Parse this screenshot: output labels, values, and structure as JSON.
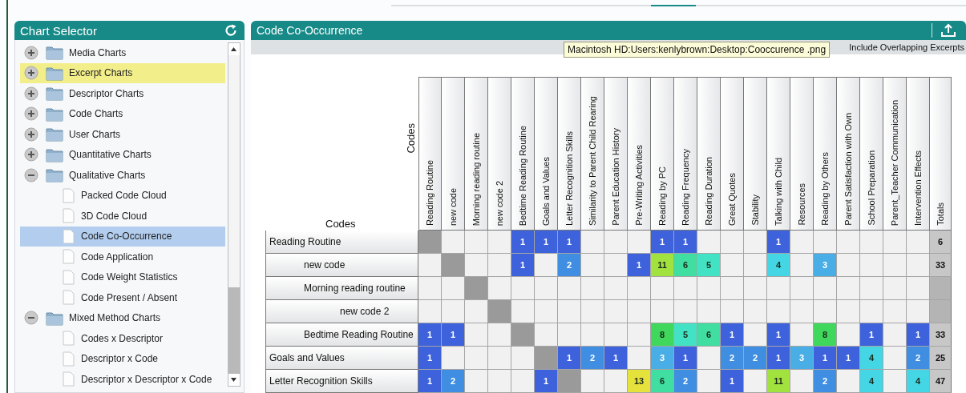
{
  "left_panel": {
    "title": "Chart Selector",
    "tree": [
      {
        "label": "Media Charts",
        "kind": "folder",
        "expanded": false,
        "selected": false,
        "highlighted": false
      },
      {
        "label": "Excerpt Charts",
        "kind": "folder",
        "expanded": false,
        "selected": false,
        "highlighted": true
      },
      {
        "label": "Descriptor Charts",
        "kind": "folder",
        "expanded": false,
        "selected": false,
        "highlighted": false
      },
      {
        "label": "Code Charts",
        "kind": "folder",
        "expanded": false,
        "selected": false,
        "highlighted": false
      },
      {
        "label": "User Charts",
        "kind": "folder",
        "expanded": false,
        "selected": false,
        "highlighted": false
      },
      {
        "label": "Quantitative Charts",
        "kind": "folder",
        "expanded": false,
        "selected": false,
        "highlighted": false
      },
      {
        "label": "Qualitative Charts",
        "kind": "folder",
        "expanded": true,
        "selected": false,
        "highlighted": false,
        "children": [
          {
            "label": "Packed Code Cloud",
            "kind": "chart",
            "selected": false,
            "highlighted": false
          },
          {
            "label": "3D Code Cloud",
            "kind": "chart",
            "selected": false,
            "highlighted": false
          },
          {
            "label": "Code Co-Occurrence",
            "kind": "chart",
            "selected": true,
            "highlighted": false
          },
          {
            "label": "Code Application",
            "kind": "chart",
            "selected": false,
            "highlighted": false
          },
          {
            "label": "Code Weight Statistics",
            "kind": "chart",
            "selected": false,
            "highlighted": false
          },
          {
            "label": "Code Present / Absent",
            "kind": "chart",
            "selected": false,
            "highlighted": false
          }
        ]
      },
      {
        "label": "Mixed Method Charts",
        "kind": "folder",
        "expanded": true,
        "selected": false,
        "highlighted": false,
        "children": [
          {
            "label": "Codes x Descriptor",
            "kind": "chart",
            "selected": false,
            "highlighted": false
          },
          {
            "label": "Descriptor x Code",
            "kind": "chart",
            "selected": false,
            "highlighted": false
          },
          {
            "label": "Descriptor x Descriptor x Code",
            "kind": "chart",
            "selected": false,
            "highlighted": false
          }
        ]
      }
    ]
  },
  "right_panel": {
    "title": "Code Co-Occurrence",
    "tooltip": "Macintosh HD:Users:kenlybrown:Desktop:Cooccurence .png",
    "option_label": "Include Overlapping Excerpts",
    "matrix": {
      "row_axis_title": "Codes",
      "column_axis_title": "Codes",
      "totals_heading": "Totals",
      "columns": [
        "Reading Routine",
        "new code",
        "Morning reading routine",
        "new code 2",
        "Bedtime Reading Routine",
        "Goals and Values",
        "Letter Recognition Skills",
        "Similarity to Parent Child Rearing",
        "Parent Education History",
        "Pre-Writing Activities",
        "Reading by PC",
        "Reading Frequency",
        "Reading Duration",
        "Great Quotes",
        "Stability",
        "Talking with Child",
        "Resources",
        "Reading by Others",
        "Parent Satisfaction with Own",
        "School Preparation",
        "Parent_Teacher Communication",
        "Intervention Effects"
      ],
      "rows": [
        {
          "label": "Reading Routine",
          "total": "6",
          "cells": [
            null,
            null,
            null,
            null,
            "1",
            "1",
            "1",
            null,
            null,
            null,
            "1",
            "1",
            null,
            null,
            null,
            "1",
            null,
            null,
            null,
            null,
            null,
            null
          ],
          "children": [
            {
              "label": "new code",
              "total": "33",
              "cells": [
                null,
                null,
                null,
                null,
                "1",
                null,
                "2",
                null,
                null,
                "1",
                "11",
                "6",
                "5",
                null,
                null,
                "4",
                null,
                "3",
                null,
                null,
                null,
                null
              ]
            },
            {
              "label": "Morning reading routine",
              "cells": [
                null,
                null,
                null,
                null,
                null,
                null,
                null,
                null,
                null,
                null,
                null,
                null,
                null,
                null,
                null,
                null,
                null,
                null,
                null,
                null,
                null,
                null
              ],
              "children": [
                {
                  "label": "new code 2",
                  "cells": [
                    null,
                    null,
                    null,
                    null,
                    null,
                    null,
                    null,
                    null,
                    null,
                    null,
                    null,
                    null,
                    null,
                    null,
                    null,
                    null,
                    null,
                    null,
                    null,
                    null,
                    null,
                    null
                  ]
                }
              ]
            },
            {
              "label": "Bedtime Reading Routine",
              "total": "33",
              "cells": [
                "1",
                "1",
                null,
                null,
                null,
                null,
                null,
                null,
                null,
                null,
                "8",
                "5",
                "6",
                "1",
                null,
                "1",
                null,
                "8",
                null,
                "1",
                null,
                "1"
              ]
            }
          ]
        },
        {
          "label": "Goals and Values",
          "total": "25",
          "cells": [
            "1",
            null,
            null,
            null,
            null,
            null,
            "1",
            "2",
            "1",
            null,
            "3",
            "1",
            null,
            "2",
            "2",
            "1",
            "3",
            "1",
            "1",
            "4",
            null,
            "2"
          ]
        },
        {
          "label": "Letter Recognition Skills",
          "total": "47",
          "cells": [
            "1",
            "2",
            null,
            null,
            null,
            "1",
            null,
            null,
            null,
            "13",
            "6",
            "2",
            null,
            "1",
            null,
            "11",
            null,
            "2",
            null,
            "4",
            null,
            "4"
          ]
        }
      ]
    }
  }
}
